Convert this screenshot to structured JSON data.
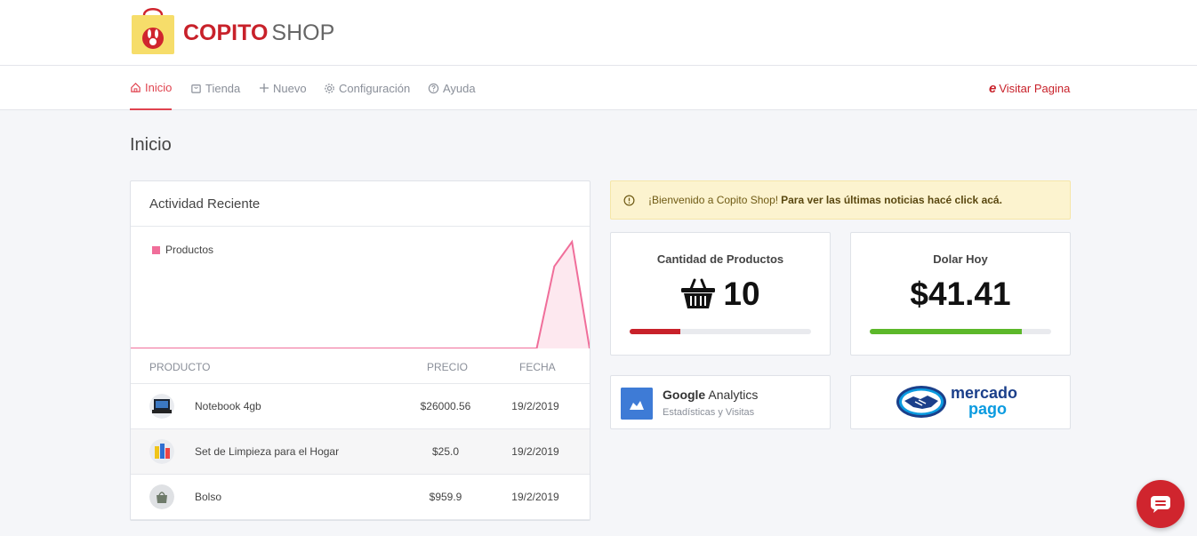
{
  "header": {
    "brand_bold": "COPITO",
    "brand_light": "SHOP",
    "logo_icon": "shopping-bag-bunny-logo"
  },
  "nav": {
    "items": [
      {
        "label": "Inicio",
        "icon": "home-icon",
        "active": true
      },
      {
        "label": "Tienda",
        "icon": "bag-icon"
      },
      {
        "label": "Nuevo",
        "icon": "plus-icon"
      },
      {
        "label": "Configuración",
        "icon": "gear-icon"
      },
      {
        "label": "Ayuda",
        "icon": "help-circle-icon"
      }
    ],
    "visit_label": "Visitar Pagina",
    "visit_icon": "e"
  },
  "page": {
    "title": "Inicio"
  },
  "activity": {
    "title": "Actividad Reciente",
    "chart_data": {
      "type": "area",
      "series": [
        {
          "name": "Productos",
          "values": [
            0,
            0,
            0,
            0,
            0,
            0,
            0,
            0,
            0,
            0,
            0,
            0,
            0,
            0,
            0,
            0,
            0,
            0,
            0,
            0,
            0,
            0,
            0,
            0,
            0.5,
            0.65,
            0
          ]
        }
      ],
      "color": "#f06e9a",
      "fill": "#fde8ef"
    },
    "table": {
      "headers": {
        "product": "PRODUCTO",
        "price": "PRECIO",
        "date": "FECHA"
      },
      "rows": [
        {
          "name": "Notebook 4gb",
          "price": "$26000.56",
          "date": "19/2/2019"
        },
        {
          "name": "Set de Limpieza para el Hogar",
          "price": "$25.0",
          "date": "19/2/2019"
        },
        {
          "name": "Bolso",
          "price": "$959.9",
          "date": "19/2/2019"
        }
      ]
    }
  },
  "alert": {
    "text": "¡Bienvenido a Copito Shop!",
    "strong": "Para ver las últimas noticias hacé click acá."
  },
  "stats": {
    "products": {
      "label": "Cantidad de Productos",
      "value": "10",
      "progress": 0.28,
      "color": "#c8212a"
    },
    "dollar": {
      "label": "Dolar Hoy",
      "value": "$41.41",
      "progress": 0.84,
      "color": "#5cb82a"
    }
  },
  "tiles": {
    "analytics": {
      "brand": "Google",
      "product": "Analytics",
      "subtitle": "Estadísticas y Visitas"
    },
    "mercadopago": {
      "line1": "mercado",
      "line2": "pago"
    }
  }
}
